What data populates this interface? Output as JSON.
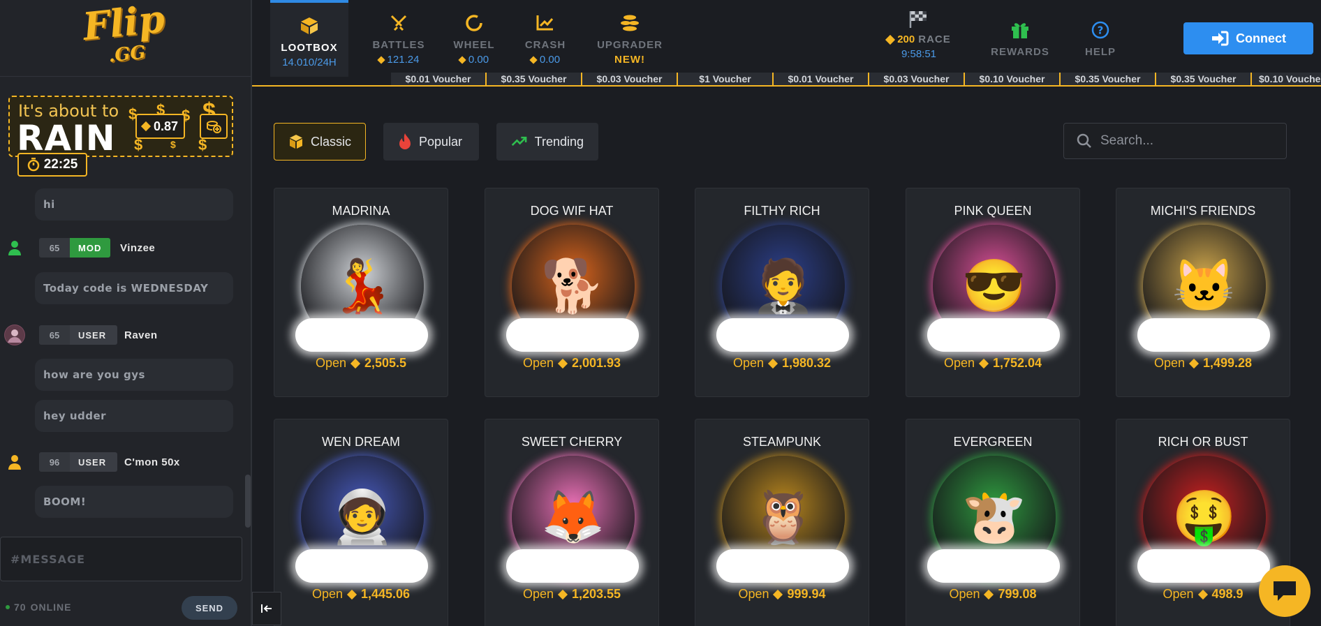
{
  "brand": {
    "logo_main": "Flip",
    "logo_sub": ".GG",
    "accent": "#f5b624",
    "primary": "#2d8ef0"
  },
  "rain": {
    "small": "It's about to",
    "big": "RAIN",
    "amount": "0.87",
    "timer": "22:25"
  },
  "chat": {
    "messages": [
      {
        "text": "hi"
      },
      {
        "level": "65",
        "role": "MOD",
        "name": "Vinzee",
        "text": "Today code is WEDNESDAY"
      },
      {
        "level": "65",
        "role": "USER",
        "name": "Raven",
        "text": "how are you gys"
      },
      {
        "text": "hey udder"
      },
      {
        "level": "96",
        "role": "USER",
        "name": "C'mon 50x",
        "text": "BOOM!"
      }
    ],
    "input_placeholder": "#MESSAGE",
    "online_count": "70",
    "online_label": "ONLINE",
    "send_label": "SEND"
  },
  "nav": {
    "items": [
      {
        "label": "LOOTBOX",
        "sub": "14.010/24H",
        "icon": "box-icon"
      },
      {
        "label": "BATTLES",
        "sub": "121.24",
        "icon": "swords-icon"
      },
      {
        "label": "WHEEL",
        "sub": "0.00",
        "icon": "wheel-icon"
      },
      {
        "label": "CRASH",
        "sub": "0.00",
        "icon": "chart-icon"
      },
      {
        "label": "UPGRADER",
        "sub": "NEW!",
        "icon": "coins-icon"
      }
    ],
    "race": {
      "amount": "200",
      "label": "RACE",
      "time": "9:58:51"
    },
    "rewards": "REWARDS",
    "help": "HELP",
    "connect": "Connect"
  },
  "ticker": [
    "$0.01 Voucher",
    "$0.35 Voucher",
    "$0.03 Voucher",
    "$1 Voucher",
    "$0.01 Voucher",
    "$0.03 Voucher",
    "$0.10 Voucher",
    "$0.35 Voucher",
    "$0.35 Voucher",
    "$0.10 Vouche"
  ],
  "filters": [
    {
      "label": "Classic",
      "icon": "cube-icon"
    },
    {
      "label": "Popular",
      "icon": "flame-icon"
    },
    {
      "label": "Trending",
      "icon": "trending-icon"
    }
  ],
  "search_placeholder": "Search...",
  "open_label": "Open",
  "boxes": [
    {
      "name": "MADRINA",
      "price": "2,505.5",
      "glyph": "💃",
      "bg": "#cfd2d6"
    },
    {
      "name": "DOG WIF HAT",
      "price": "2,001.93",
      "glyph": "🐕",
      "bg": "#d8641c"
    },
    {
      "name": "FILTHY RICH",
      "price": "1,980.32",
      "glyph": "🤵",
      "bg": "#2c3f8a"
    },
    {
      "name": "PINK QUEEN",
      "price": "1,752.04",
      "glyph": "😎",
      "bg": "#d94f96"
    },
    {
      "name": "MICHI'S FRIENDS",
      "price": "1,499.28",
      "glyph": "🐱",
      "bg": "#c9a24a"
    },
    {
      "name": "WEN DREAM",
      "price": "1,445.06",
      "glyph": "🧑‍🚀",
      "bg": "#4658b8"
    },
    {
      "name": "SWEET CHERRY",
      "price": "1,203.55",
      "glyph": "🦊",
      "bg": "#e86fb4"
    },
    {
      "name": "STEAMPUNK",
      "price": "999.94",
      "glyph": "🦉",
      "bg": "#b8861e"
    },
    {
      "name": "EVERGREEN",
      "price": "799.08",
      "glyph": "🐮",
      "bg": "#2f9a3f"
    },
    {
      "name": "RICH OR BUST",
      "price": "498.9",
      "glyph": "🤑",
      "bg": "#c82020"
    }
  ]
}
